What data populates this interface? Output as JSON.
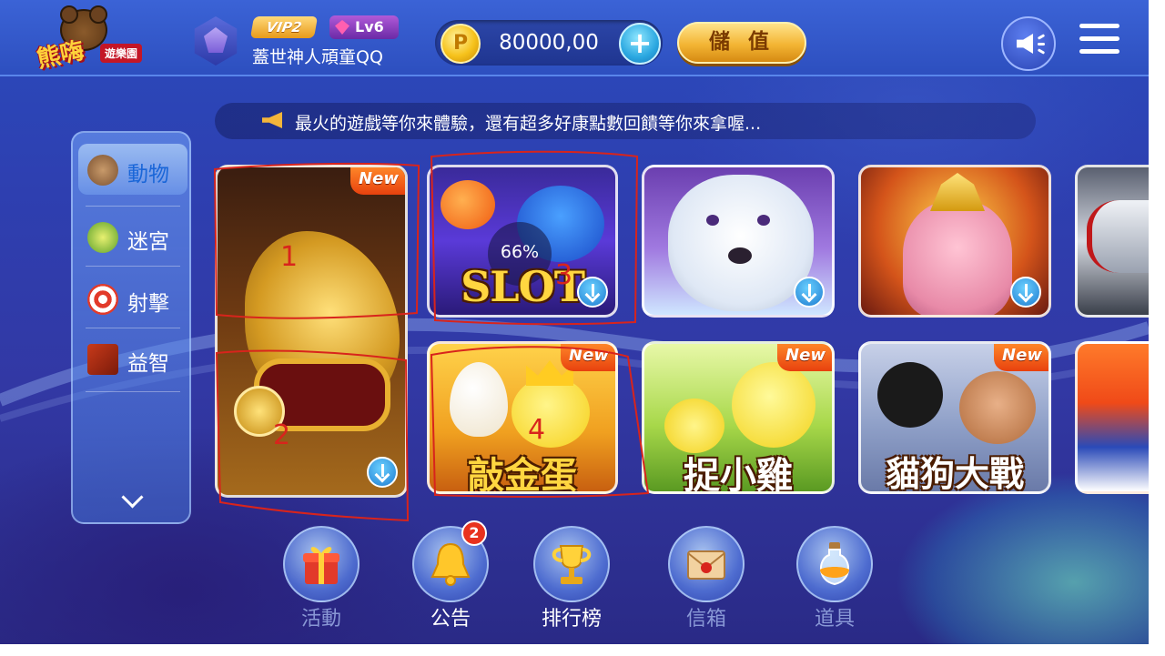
{
  "header": {
    "logo_text": "熊嗨",
    "logo_subtext": "遊樂園",
    "vip_label": "VIP2",
    "level_label": "Lv6",
    "nickname": "蓋世神人頑童QQ",
    "coin_icon_glyph": "P",
    "balance": "80000,00",
    "add_glyph": "+",
    "deposit_label": "儲 值"
  },
  "marquee": {
    "text": "最火的遊戲等你來體驗，還有超多好康點數回饋等你來拿喔..."
  },
  "sidebar": {
    "items": [
      {
        "label": "動物",
        "icon": "animal-icon",
        "active": true
      },
      {
        "label": "迷宮",
        "icon": "maze-icon",
        "active": false
      },
      {
        "label": "射擊",
        "icon": "target-icon",
        "active": false
      },
      {
        "label": "益智",
        "icon": "book-icon",
        "active": false
      }
    ],
    "more_icon": "chevron-down-icon"
  },
  "games": {
    "dino": {
      "new_badge": "New",
      "download_icon": "download-icon"
    },
    "slot": {
      "title": "SLOT",
      "download_progress": "66%",
      "download_icon": "download-icon"
    },
    "polar_bear": {
      "download_icon": "download-icon"
    },
    "ganesha": {
      "download_icon": "download-icon"
    },
    "egg": {
      "title": "敲金蛋",
      "new_badge": "New"
    },
    "chick": {
      "title": "捉小雞",
      "new_badge": "New"
    },
    "catdog": {
      "title": "貓狗大戰",
      "new_badge": "New"
    }
  },
  "bottom_nav": {
    "items": [
      {
        "label": "活動",
        "icon": "gift-icon",
        "dimmed": true
      },
      {
        "label": "公告",
        "icon": "bell-icon",
        "dimmed": false,
        "badge": "2"
      },
      {
        "label": "排行榜",
        "icon": "trophy-icon",
        "dimmed": false
      },
      {
        "label": "信箱",
        "icon": "mail-icon",
        "dimmed": true
      },
      {
        "label": "道具",
        "icon": "potion-icon",
        "dimmed": true
      }
    ]
  },
  "annotations": {
    "mark_1": "1",
    "mark_2": "2",
    "mark_3": "3",
    "mark_4": "4"
  },
  "colors": {
    "accent_gold": "#f3b534",
    "new_badge": "#e8410e",
    "download_blue": "#1e7bd0",
    "active_tab_text": "#1a66d8",
    "annotation_red": "#d8241c"
  }
}
